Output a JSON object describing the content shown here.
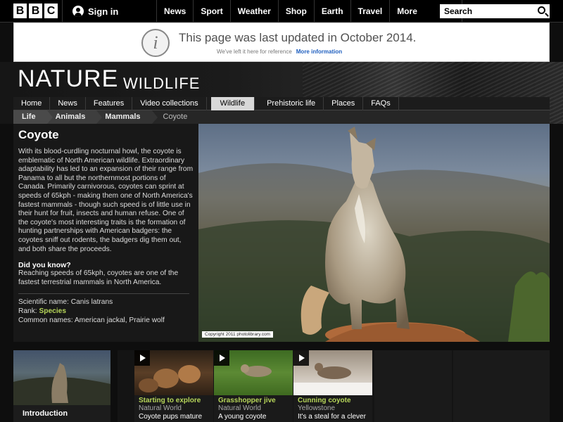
{
  "bbc_bar": {
    "logo_letters": [
      "B",
      "B",
      "C"
    ],
    "signin": "Sign in",
    "nav": [
      "News",
      "Sport",
      "Weather",
      "Shop",
      "Earth",
      "Travel"
    ],
    "more": "More",
    "search_placeholder": "Search"
  },
  "notice": {
    "icon": "i",
    "title": "This page was last updated in October 2014.",
    "subtitle": "We've left it here for reference",
    "link": "More information"
  },
  "brand": {
    "nature": "NATURE",
    "wildlife": "WILDLIFE"
  },
  "subnav": [
    "Home",
    "News",
    "Features",
    "Video collections",
    "Wildlife",
    "Prehistoric life",
    "Places",
    "FAQs"
  ],
  "breadcrumbs": [
    "Life",
    "Animals",
    "Mammals",
    "Coyote"
  ],
  "article": {
    "title": "Coyote",
    "body": "With its blood-curdling nocturnal howl, the coyote is emblematic of North American wildlife. Extraordinary adaptability has led to an expansion of their range from Panama to all but the northernmost portions of Canada. Primarily carnivorous, coyotes can sprint at speeds of 65kph - making them one of North America's fastest mammals - though such speed is of little use in their hunt for fruit, insects and human refuse. One of the coyote's most interesting traits is the formation of hunting partnerships with American badgers: the coyotes sniff out rodents, the badgers dig them out, and both share the proceeds.",
    "did_you_know_heading": "Did you know?",
    "did_you_know": "Reaching speeds of 65kph, coyotes are one of the fastest terrestrial mammals in North America.",
    "scientific_name_label": "Scientific name:",
    "scientific_name": "Canis latrans",
    "rank_label": "Rank:",
    "rank": "Species",
    "common_names_label": "Common names:",
    "common_names": "American jackal, Prairie wolf"
  },
  "hero": {
    "copyright": "Copyright 2011 photolibrary.com"
  },
  "intro": {
    "label": "Introduction"
  },
  "promos": [
    {
      "title": "Starting to explore",
      "source": "Natural World",
      "desc": "Coyote pups mature"
    },
    {
      "title": "Grasshopper jive",
      "source": "Natural World",
      "desc": "A young coyote"
    },
    {
      "title": "Cunning coyote",
      "source": "Yellowstone",
      "desc": "It's a steal for a clever"
    }
  ]
}
